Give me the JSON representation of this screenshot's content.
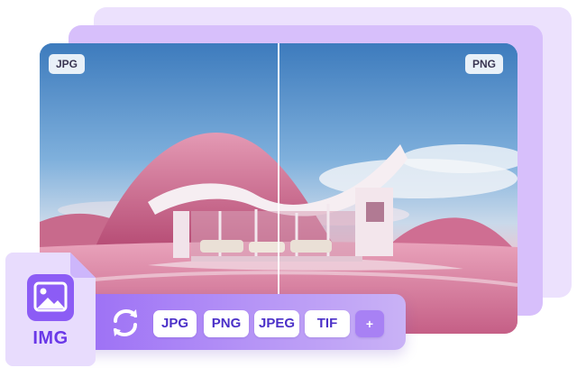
{
  "preview": {
    "left_format": "JPG",
    "right_format": "PNG"
  },
  "toolbar": {
    "swap_icon": "swap-arrows-icon",
    "formats": [
      "JPG",
      "PNG",
      "JPEG",
      "TIF"
    ],
    "add_label": "+"
  },
  "file_badge": {
    "icon": "image-file-icon",
    "label": "IMG"
  },
  "colors": {
    "accent": "#8b5cf6",
    "accent_dark": "#6a38e8",
    "chip_text": "#4b30c8",
    "card_back": "#ece1fd",
    "card_mid": "#d7bffb"
  }
}
